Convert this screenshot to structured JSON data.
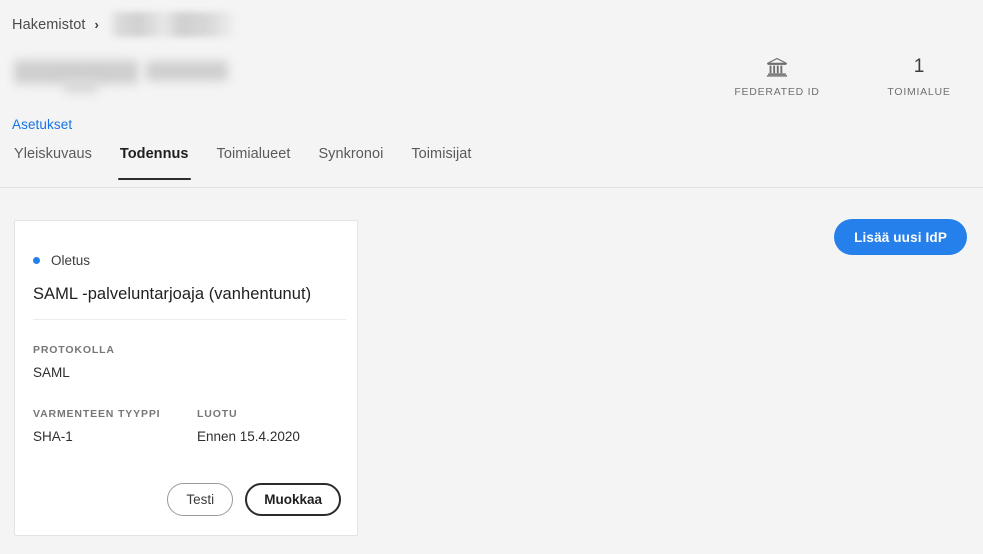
{
  "breadcrumb": {
    "root_label": "Hakemistot",
    "separator": "›",
    "current_label_redacted": true
  },
  "header": {
    "title_redacted": true,
    "stats": [
      {
        "icon": "bank-building-icon",
        "value": "",
        "label": "FEDERATED ID"
      },
      {
        "icon": "",
        "value": "1",
        "label": "TOIMIALUE"
      }
    ]
  },
  "settings": {
    "link_label": "Asetukset"
  },
  "tabs": [
    {
      "label": "Yleiskuvaus",
      "active": false
    },
    {
      "label": "Todennus",
      "active": true
    },
    {
      "label": "Toimialueet",
      "active": false
    },
    {
      "label": "Synkronoi",
      "active": false
    },
    {
      "label": "Toimisijat",
      "active": false
    }
  ],
  "actions": {
    "add_idp_label": "Lisää uusi IdP"
  },
  "idp_card": {
    "badge_label": "Oletus",
    "title": "SAML -palveluntarjoaja (vanhentunut)",
    "fields": [
      {
        "label": "PROTOKOLLA",
        "value": "SAML"
      },
      {
        "label": "VARMENTEEN TYYPPI",
        "value": "SHA-1"
      },
      {
        "label": "LUOTU",
        "value": "Ennen 15.4.2020"
      }
    ],
    "buttons": {
      "test_label": "Testi",
      "edit_label": "Muokkaa"
    }
  },
  "colors": {
    "accent_blue": "#2680eb",
    "link_blue": "#1473e6",
    "page_background": "#f4f4f4",
    "card_background": "#ffffff",
    "active_tab_underline": "#2c2c2c"
  }
}
